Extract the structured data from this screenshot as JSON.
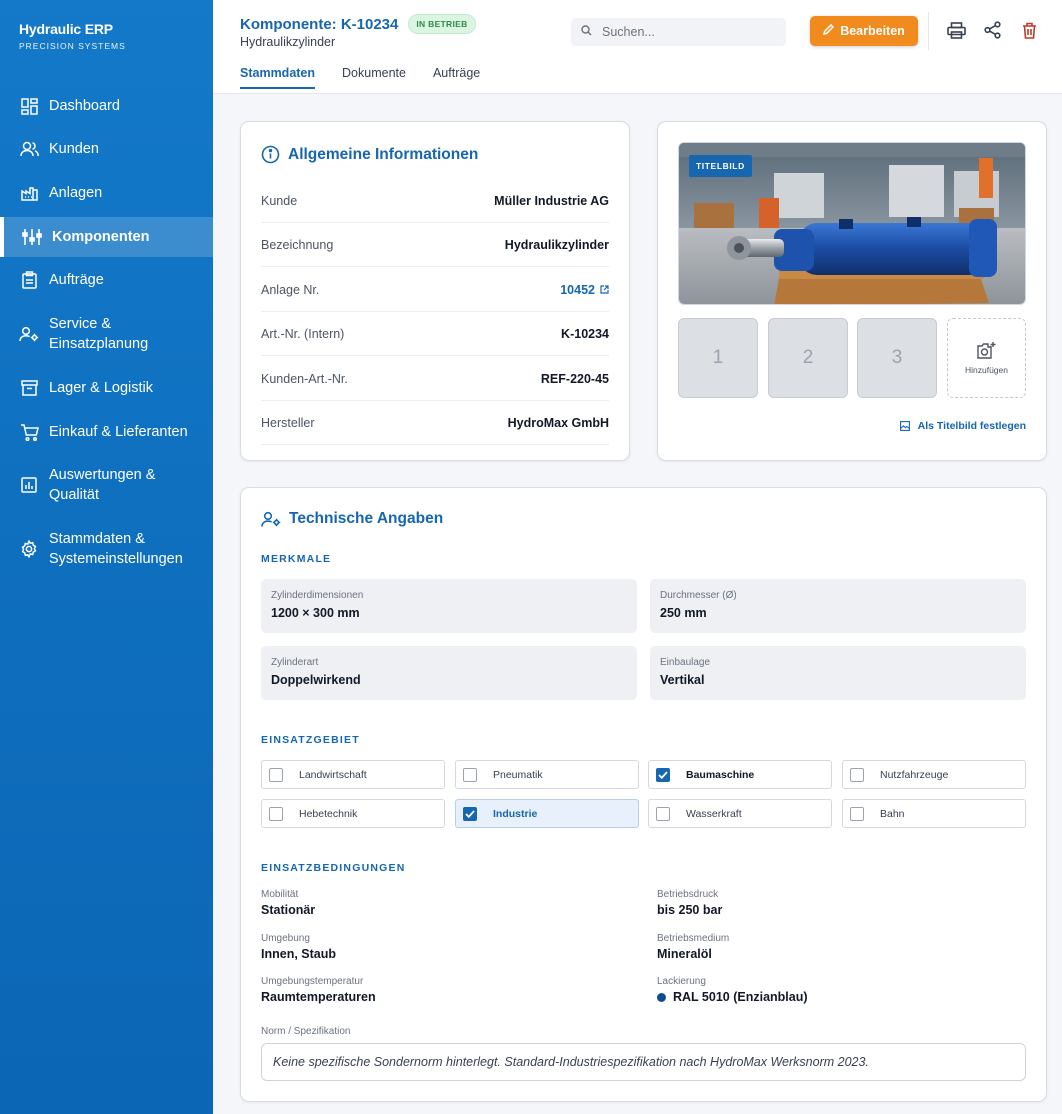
{
  "brand": {
    "title": "Hydraulic ERP",
    "subtitle": "PRECISION SYSTEMS"
  },
  "sidebar": {
    "items": [
      {
        "label": "Dashboard",
        "icon": "dashboard-icon"
      },
      {
        "label": "Kunden",
        "icon": "users-icon"
      },
      {
        "label": "Anlagen",
        "icon": "factory-icon"
      },
      {
        "label": "Komponenten",
        "icon": "components-icon",
        "active": true
      },
      {
        "label": "Aufträge",
        "icon": "clipboard-icon"
      },
      {
        "label": "Service & Einsatzplanung",
        "icon": "service-icon"
      },
      {
        "label": "Lager & Logistik",
        "icon": "archive-icon"
      },
      {
        "label": "Einkauf & Lieferanten",
        "icon": "cart-icon"
      },
      {
        "label": "Auswertungen & Qualität",
        "icon": "chart-icon"
      },
      {
        "label": "Stammdaten & Systemeinstellungen",
        "icon": "gear-icon"
      }
    ]
  },
  "header": {
    "title": "Komponente: K-10234",
    "status": "IN BETRIEB",
    "subtitle": "Hydraulikzylinder",
    "search_placeholder": "Suchen...",
    "edit_label": "Bearbeiten",
    "tabs": [
      "Stammdaten",
      "Dokumente",
      "Aufträge"
    ]
  },
  "info": {
    "title": "Allgemeine Informationen",
    "rows": [
      {
        "key": "Kunde",
        "value": "Müller Industrie AG"
      },
      {
        "key": "Bezeichnung",
        "value": "Hydraulikzylinder"
      },
      {
        "key": "Anlage Nr.",
        "value": "10452"
      },
      {
        "key": "Art.-Nr. (Intern)",
        "value": "K-10234"
      },
      {
        "key": "Kunden-Art.-Nr.",
        "value": "REF-220-45"
      },
      {
        "key": "Hersteller",
        "value": "HydroMax GmbH"
      }
    ]
  },
  "gallery": {
    "badge": "TITELBILD",
    "thumbs": [
      "1",
      "2",
      "3"
    ],
    "add_label": "Hinzufügen",
    "set_cover_label": "Als Titelbild festlegen"
  },
  "tech": {
    "title": "Technische Angaben",
    "features_label": "MERKMALE",
    "features": [
      {
        "key": "Zylinderdimensionen",
        "value": "1200 × 300 mm"
      },
      {
        "key": "Durchmesser (Ø)",
        "value": "250 mm"
      },
      {
        "key": "Zylinderart",
        "value": "Doppelwirkend"
      },
      {
        "key": "Einbaulage",
        "value": "Vertikal"
      }
    ],
    "usage_label": "EINSATZGEBIET",
    "usage": [
      {
        "label": "Landwirtschaft",
        "checked": false
      },
      {
        "label": "Pneumatik",
        "checked": false
      },
      {
        "label": "Baumaschine",
        "checked": true
      },
      {
        "label": "Nutzfahrzeuge",
        "checked": false
      },
      {
        "label": "Hebetechnik",
        "checked": false
      },
      {
        "label": "Industrie",
        "checked": true
      },
      {
        "label": "Wasserkraft",
        "checked": false
      },
      {
        "label": "Bahn",
        "checked": false
      }
    ],
    "conditions_label": "EINSATZBEDINGUNGEN",
    "conditions": [
      {
        "key": "Mobilität",
        "value": "Stationär"
      },
      {
        "key": "Betriebsdruck",
        "value": "bis 250 bar"
      },
      {
        "key": "Umgebung",
        "value": "Innen, Staub"
      },
      {
        "key": "Betriebsmedium",
        "value": "Mineralöl"
      },
      {
        "key": "Umgebungstemperatur",
        "value": "Raumtemperaturen"
      },
      {
        "key": "Lackierung",
        "value": "RAL 5010 (Enzianblau)",
        "swatch": "#0e4c92"
      }
    ],
    "norm_label": "Norm / Spezifikation",
    "norm_text": "Keine spezifische Sondernorm hinterlegt. Standard-Industriespezifikation nach HydroMax Werksnorm 2023."
  },
  "colors": {
    "primary": "#1666b0",
    "accent": "#f28b1e",
    "delete": "#c0392b"
  }
}
